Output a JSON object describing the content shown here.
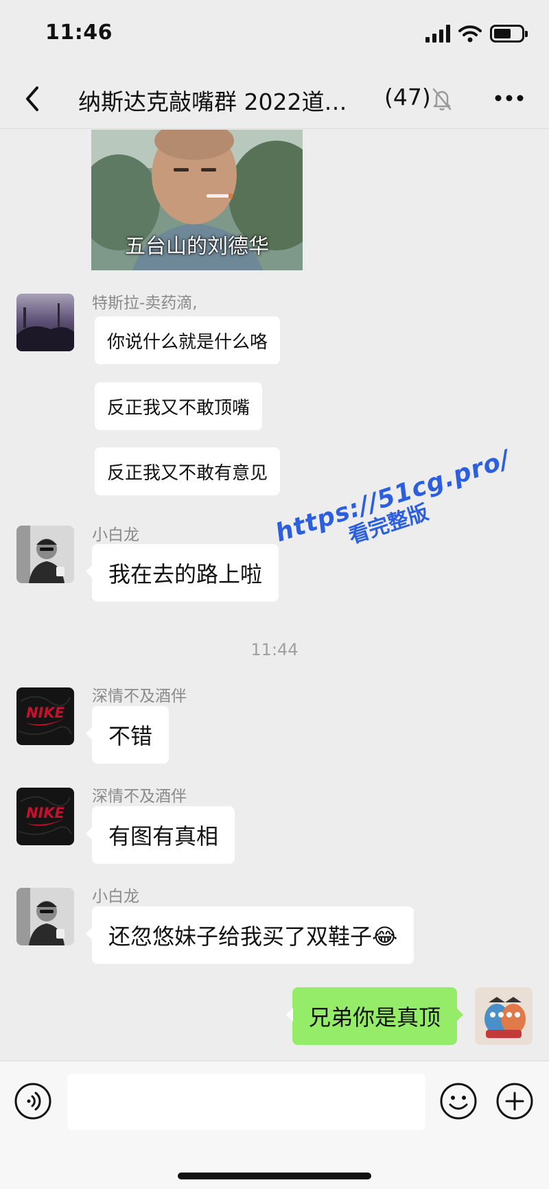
{
  "status_bar": {
    "time": "11:46"
  },
  "nav": {
    "title": "纳斯达克敲嘴群 2022道…",
    "member_count": "(47)"
  },
  "meme": {
    "caption": "五台山的刘德华"
  },
  "messages": [
    {
      "sender": "特斯拉-卖药滴,",
      "lines": [
        "你说什么就是什么咯",
        "反正我又不敢顶嘴",
        "反正我又不敢有意见"
      ]
    },
    {
      "sender": "小白龙",
      "text": "我在去的路上啦"
    },
    {
      "sender": "深情不及酒伴",
      "text": "不错"
    },
    {
      "sender": "深情不及酒伴",
      "text": "有图有真相"
    },
    {
      "sender": "小白龙",
      "text": "还忽悠妹子给我买了双鞋子😂"
    }
  ],
  "time_separator": "11:44",
  "my_message": {
    "text": "兄弟你是真顶"
  },
  "avatars": {
    "nike_label": "NIKE"
  },
  "watermark": {
    "line1": "https://51cg.pro/",
    "line2": "看完整版"
  },
  "colors": {
    "my_bubble": "#95ec69",
    "background": "#ededed",
    "nike_red": "#c8102e"
  }
}
